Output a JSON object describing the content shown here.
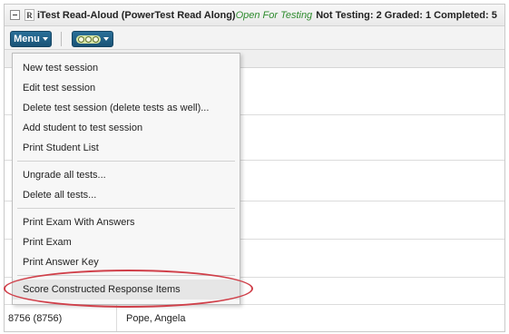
{
  "header": {
    "title": "iTest Read-Aloud (PowerTest Read Along)",
    "status": "Open For Testing",
    "counts": "Not Testing: 2 Graded: 1 Completed: 5",
    "badge": "R"
  },
  "toolbar": {
    "menu_label": "Menu"
  },
  "menu": {
    "items": [
      "New test session",
      "Edit test session",
      "Delete test session (delete tests as well)...",
      "Add student to test session",
      "Print Student List",
      "Ungrade all tests...",
      "Delete all tests...",
      "Print Exam With Answers",
      "Print Exam",
      "Print Answer Key",
      "Score Constructed Response Items"
    ]
  },
  "table": {
    "rows": [
      {
        "id": "8756 (8756)",
        "name": "Pope, Angela"
      }
    ]
  },
  "colors": {
    "status_open": "#2e8b2e",
    "toolbar_button": "#1f5e85",
    "callout": "#d0404a"
  }
}
